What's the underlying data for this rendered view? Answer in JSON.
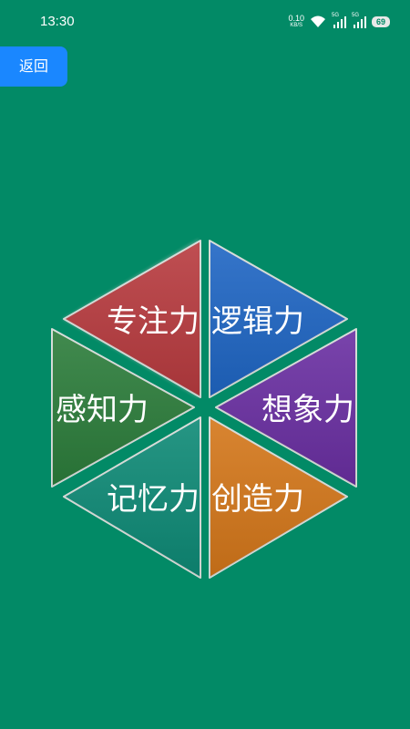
{
  "status": {
    "time": "13:30",
    "net_speed": "0.10",
    "net_unit": "KB/S",
    "sig_label": "5G",
    "battery": "69"
  },
  "nav": {
    "back_label": "返回"
  },
  "abilities": [
    {
      "label": "专注力",
      "color": "#b83b3f"
    },
    {
      "label": "逻辑力",
      "color": "#1f66c4"
    },
    {
      "label": "想象力",
      "color": "#6a2fa2"
    },
    {
      "label": "创造力",
      "color": "#d4771a"
    },
    {
      "label": "记忆力",
      "color": "#0e8a76"
    },
    {
      "label": "感知力",
      "color": "#2c7d3b"
    }
  ]
}
